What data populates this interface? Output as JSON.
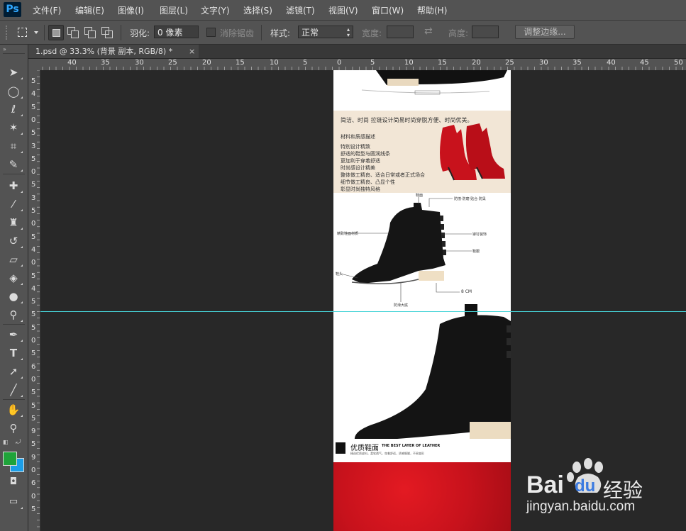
{
  "app": {
    "logo": "Ps"
  },
  "menu": [
    "文件(F)",
    "编辑(E)",
    "图像(I)",
    "图层(L)",
    "文字(Y)",
    "选择(S)",
    "滤镜(T)",
    "视图(V)",
    "窗口(W)",
    "帮助(H)"
  ],
  "options": {
    "feather_label": "羽化:",
    "feather_value": "0 像素",
    "antialias_label": "消除锯齿",
    "style_label": "样式:",
    "style_value": "正常",
    "width_label": "宽度:",
    "height_label": "高度:",
    "refine_edge_label": "调整边缘..."
  },
  "document_tab": {
    "title": "1.psd @ 33.3% (背景 副本, RGB/8) *",
    "close": "×"
  },
  "rulers": {
    "horizontal": [
      "45",
      "40",
      "35",
      "30",
      "25",
      "20",
      "15",
      "10",
      "5",
      "0",
      "5",
      "10",
      "15",
      "20",
      "25",
      "30",
      "35",
      "40",
      "45",
      "50"
    ],
    "vertical": [
      "5",
      "4",
      "5",
      "0",
      "5",
      "3",
      "5",
      "0",
      "5",
      "3",
      "5",
      "0",
      "5",
      "4",
      "0",
      "5",
      "4",
      "5",
      "5",
      "5",
      "0",
      "5",
      "6",
      "0",
      "5",
      "5",
      "5",
      "9",
      "5",
      "9",
      "0",
      "6",
      "0",
      "5"
    ]
  },
  "document": {
    "banner_title": "简洁、时尚     拉链设计简易时尚穿脱方便、时尚优美。",
    "features": [
      "材料和质感描述",
      "特别设计精致",
      "舒适的鞋型与圆润线条",
      "更加利于穿着舒适",
      "时尚感设计精美",
      "整体做工精良、适合日常或者正式场合",
      "细节做工精良、凸显个性",
      "彰显时尚独特风格"
    ],
    "callouts": {
      "top": "鞋面",
      "right_top": "防撞·防磨·贴合·防臭",
      "left": "精致鞋面材质",
      "right_mid": "铆钉装饰",
      "right_bottom": "鞋跟",
      "left_bottom": "鞋头",
      "heel": "8 CM",
      "sole": "防滑大底"
    },
    "quality_title": "优质鞋面",
    "quality_subtitle": "THE BEST LAYER OF LEATHER",
    "quality_desc": "精选优质皮料，柔软透气，穿着舒适，质感细腻，不易变形"
  },
  "watermark": {
    "brand": "Bai",
    "brand_suffix": "du",
    "product": "经验",
    "url": "jingyan.baidu.com"
  },
  "colors": {
    "foreground": "#1fa33a",
    "background": "#1b9ee8",
    "guide": "#47d4d8",
    "boot_red": "#c8121c"
  }
}
